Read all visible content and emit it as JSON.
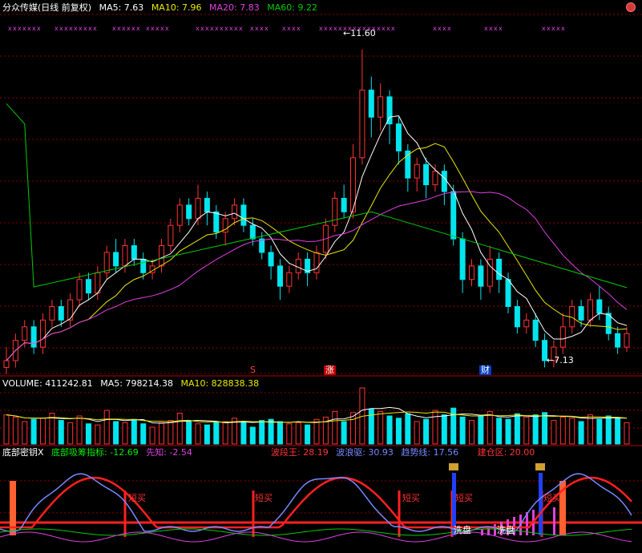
{
  "colors": {
    "up": "#ff3333",
    "down": "#00e5ee",
    "ma5": "#ffffff",
    "ma10": "#e8e800",
    "ma20": "#e040e0",
    "ma60": "#00cc00",
    "grid": "#8a0000"
  },
  "header": {
    "title": "分众传媒(日线 前复权)",
    "ma5": "MA5: 7.63",
    "ma10": "MA10: 7.96",
    "ma20": "MA20: 7.83",
    "ma60": "MA60: 9.22",
    "close_icon": "close-icon"
  },
  "price_panel": {
    "high_label": "11.60",
    "low_label": "7.13",
    "marker_top": "xxxxxx",
    "event_s": "S",
    "event_zhang": "涨",
    "event_cai": "财"
  },
  "volume_panel": {
    "vol": "VOLUME: 411242.81",
    "ma5": "MA5: 798214.38",
    "ma10": "MA10: 828838.38"
  },
  "indicator_panel": {
    "name": "底部密钥X",
    "dibu": "底部吸筹指标: -12.69",
    "xianzhi": "先知: -2.54",
    "boduan": "波段王: 28.19",
    "bolang": "波浪驱: 30.93",
    "qushi": "趋势线: 17.56",
    "jiancang": "建仓区: 20.00",
    "buy_label": "短买",
    "wash_label": "洗盘"
  },
  "chart_data": {
    "type": "candlestick",
    "candles": [
      [
        6.9,
        7.0,
        7.2,
        6.8
      ],
      [
        7.0,
        7.3,
        7.4,
        6.9
      ],
      [
        7.3,
        7.5,
        7.6,
        7.2
      ],
      [
        7.5,
        7.2,
        7.6,
        7.1
      ],
      [
        7.2,
        7.6,
        7.7,
        7.1
      ],
      [
        7.6,
        7.8,
        7.9,
        7.5
      ],
      [
        7.8,
        7.6,
        7.9,
        7.5
      ],
      [
        7.6,
        7.9,
        8.0,
        7.5
      ],
      [
        7.9,
        8.2,
        8.3,
        7.8
      ],
      [
        8.2,
        8.0,
        8.3,
        7.9
      ],
      [
        8.0,
        8.3,
        8.4,
        7.9
      ],
      [
        8.3,
        8.6,
        8.7,
        8.2
      ],
      [
        8.6,
        8.4,
        8.8,
        8.3
      ],
      [
        8.4,
        8.7,
        8.8,
        8.3
      ],
      [
        8.7,
        8.5,
        8.8,
        8.4
      ],
      [
        8.5,
        8.3,
        8.6,
        8.2
      ],
      [
        8.3,
        8.4,
        8.5,
        8.2
      ],
      [
        8.4,
        8.7,
        8.8,
        8.3
      ],
      [
        8.7,
        9.0,
        9.1,
        8.6
      ],
      [
        9.0,
        9.3,
        9.4,
        8.9
      ],
      [
        9.3,
        9.1,
        9.4,
        9.0
      ],
      [
        9.1,
        9.4,
        9.6,
        9.0
      ],
      [
        9.4,
        9.2,
        9.5,
        9.0
      ],
      [
        9.2,
        8.9,
        9.3,
        8.8
      ],
      [
        8.9,
        9.1,
        9.2,
        8.7
      ],
      [
        9.1,
        9.3,
        9.4,
        9.0
      ],
      [
        9.3,
        9.0,
        9.4,
        8.9
      ],
      [
        9.0,
        8.8,
        9.1,
        8.7
      ],
      [
        8.8,
        8.6,
        8.9,
        8.5
      ],
      [
        8.6,
        8.4,
        8.7,
        8.2
      ],
      [
        8.4,
        8.1,
        8.5,
        7.9
      ],
      [
        8.1,
        8.3,
        8.4,
        8.0
      ],
      [
        8.3,
        8.5,
        8.6,
        8.2
      ],
      [
        8.5,
        8.3,
        8.6,
        8.1
      ],
      [
        8.3,
        8.6,
        8.7,
        8.2
      ],
      [
        8.6,
        9.0,
        9.1,
        8.5
      ],
      [
        9.0,
        9.4,
        9.5,
        8.9
      ],
      [
        9.4,
        9.2,
        9.6,
        9.1
      ],
      [
        9.2,
        10.0,
        10.2,
        9.1
      ],
      [
        10.0,
        11.0,
        11.6,
        9.9
      ],
      [
        11.0,
        10.6,
        11.2,
        10.3
      ],
      [
        10.6,
        10.9,
        11.1,
        10.4
      ],
      [
        10.9,
        10.5,
        11.0,
        10.2
      ],
      [
        10.5,
        10.1,
        10.6,
        9.9
      ],
      [
        10.1,
        9.7,
        10.2,
        9.5
      ],
      [
        9.7,
        9.9,
        10.0,
        9.5
      ],
      [
        9.9,
        9.6,
        10.0,
        9.4
      ],
      [
        9.6,
        9.8,
        9.9,
        9.5
      ],
      [
        9.8,
        9.5,
        9.9,
        9.3
      ],
      [
        9.5,
        8.8,
        9.6,
        8.7
      ],
      [
        8.8,
        8.2,
        8.9,
        8.0
      ],
      [
        8.2,
        8.4,
        8.5,
        8.1
      ],
      [
        8.4,
        8.1,
        8.5,
        7.9
      ],
      [
        8.1,
        8.5,
        8.7,
        8.0
      ],
      [
        8.5,
        8.2,
        8.6,
        8.0
      ],
      [
        8.2,
        7.8,
        8.3,
        7.7
      ],
      [
        7.8,
        7.5,
        7.9,
        7.4
      ],
      [
        7.5,
        7.6,
        7.7,
        7.4
      ],
      [
        7.6,
        7.3,
        7.7,
        7.2
      ],
      [
        7.3,
        7.0,
        7.4,
        6.9
      ],
      [
        7.0,
        7.2,
        7.3,
        6.9
      ],
      [
        7.2,
        7.5,
        7.7,
        7.1
      ],
      [
        7.5,
        7.8,
        7.9,
        7.4
      ],
      [
        7.8,
        7.6,
        7.9,
        7.5
      ],
      [
        7.6,
        7.9,
        8.0,
        7.5
      ],
      [
        7.9,
        7.7,
        8.1,
        7.6
      ],
      [
        7.7,
        7.4,
        7.8,
        7.3
      ],
      [
        7.4,
        7.2,
        7.5,
        7.1
      ],
      [
        7.2,
        7.4,
        7.5,
        7.13
      ]
    ],
    "volume": [
      52,
      48,
      40,
      44,
      46,
      55,
      42,
      38,
      50,
      36,
      34,
      60,
      40,
      38,
      44,
      36,
      30,
      38,
      42,
      55,
      40,
      36,
      34,
      38,
      40,
      46,
      38,
      30,
      42,
      44,
      40,
      36,
      38,
      34,
      44,
      48,
      58,
      40,
      56,
      100,
      62,
      58,
      50,
      46,
      54,
      40,
      44,
      60,
      52,
      64,
      48,
      42,
      50,
      58,
      46,
      44,
      54,
      48,
      52,
      56,
      42,
      48,
      46,
      40,
      52,
      44,
      50,
      46,
      38
    ],
    "ylim": [
      7.0,
      12.0
    ]
  }
}
